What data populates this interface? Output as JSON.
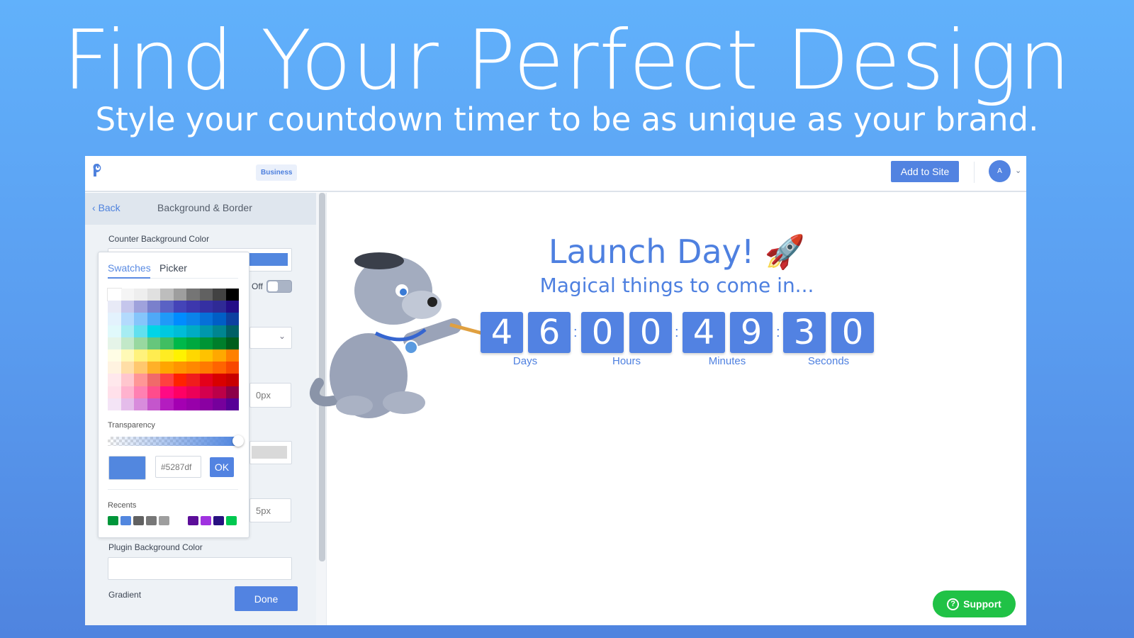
{
  "hero": {
    "title": "Find Your Perfect Design",
    "subtitle": "Style your countdown timer to be as unique as your brand."
  },
  "topbar": {
    "plan_badge": "Business",
    "add_to_site": "Add to Site",
    "avatar_initial": "A",
    "logo_icon": "poptin-logo-icon",
    "chevron_icon": "chevron-down-icon"
  },
  "panel": {
    "back": "Back",
    "title": "Background & Border",
    "counter_bg_label": "Counter Background Color",
    "counter_bg_color": "#5287df",
    "toggle_label": "Off",
    "toggle_on": false,
    "border_width": "0px",
    "radius": "5px",
    "plugin_bg_label": "Plugin Background Color",
    "gradient_label": "Gradient",
    "done": "Done"
  },
  "picker": {
    "tabs": [
      {
        "label": "Swatches",
        "active": true
      },
      {
        "label": "Picker",
        "active": false
      }
    ],
    "swatches": [
      [
        "#ffffff",
        "#f5f5f5",
        "#eeeeee",
        "#e0e0e0",
        "#bdbdbd",
        "#9e9e9e",
        "#757575",
        "#616161",
        "#424242",
        "#000000"
      ],
      [
        "#e8eaf6",
        "#c5c6ec",
        "#9fa2dc",
        "#7a80cc",
        "#5a62c4",
        "#4444b8",
        "#3d37ad",
        "#3530a2",
        "#2f2a96",
        "#240e88"
      ],
      [
        "#e3f2fd",
        "#b3dafd",
        "#85c5fb",
        "#4fa9f7",
        "#1f9af8",
        "#008cff",
        "#0a83ea",
        "#0670d8",
        "#005ec6",
        "#0d40a0"
      ],
      [
        "#e0f9fb",
        "#a6ecf2",
        "#62e0ee",
        "#00d4e6",
        "#00c8e0",
        "#00bcd8",
        "#00acc4",
        "#0097ac",
        "#008590",
        "#006066"
      ],
      [
        "#e5f4e8",
        "#c2e8c8",
        "#98d8a0",
        "#66c67c",
        "#40be62",
        "#00b84a",
        "#00a83f",
        "#009435",
        "#007e2b",
        "#005e1c"
      ],
      [
        "#fffde5",
        "#fff9b6",
        "#fff27c",
        "#ffec50",
        "#ffec22",
        "#fff200",
        "#ffd800",
        "#ffc200",
        "#ffa800",
        "#ff8000"
      ],
      [
        "#fff3e0",
        "#ffdea6",
        "#ffc86e",
        "#ffb028",
        "#ffa500",
        "#ff9400",
        "#ff8800",
        "#ff7a00",
        "#ff6400",
        "#f84800"
      ],
      [
        "#ffe8ec",
        "#ffc6ce",
        "#ff9696",
        "#f06a6a",
        "#ff4040",
        "#ff2200",
        "#f01c1c",
        "#e4001a",
        "#d80000",
        "#c80000"
      ],
      [
        "#ffe0ea",
        "#ffb2ce",
        "#ff80b2",
        "#ff4c8c",
        "#ff0a84",
        "#ff0064",
        "#ec0058",
        "#d4004e",
        "#bc0048",
        "#8c0048"
      ],
      [
        "#f4e4f6",
        "#e4bcea",
        "#d88cdc",
        "#c456cc",
        "#b41cc0",
        "#a400b2",
        "#9800aa",
        "#8a00a2",
        "#76009c",
        "#560096"
      ]
    ],
    "transparency_label": "Transparency",
    "opacity_percent": 100,
    "hex_value": "#5287df",
    "ok": "OK",
    "recents_label": "Recents",
    "recents": [
      "#00963a",
      "#5287df",
      "#616161",
      "#777777",
      "#9e9e9e",
      null,
      "#5c0e99",
      "#a032e0",
      "#281080",
      "#00c850"
    ]
  },
  "preview": {
    "title": "Launch Day! 🚀",
    "subtitle": "Magical things to come in...",
    "digits": [
      "4",
      "6",
      "0",
      "0",
      "4",
      "9",
      "3",
      "0"
    ],
    "units": [
      "Days",
      "Hours",
      "Minutes",
      "Seconds"
    ],
    "separator": ":",
    "accent": "#5282e2"
  },
  "support": {
    "label": "Support",
    "icon": "question-circle-icon",
    "color": "#20c246"
  }
}
